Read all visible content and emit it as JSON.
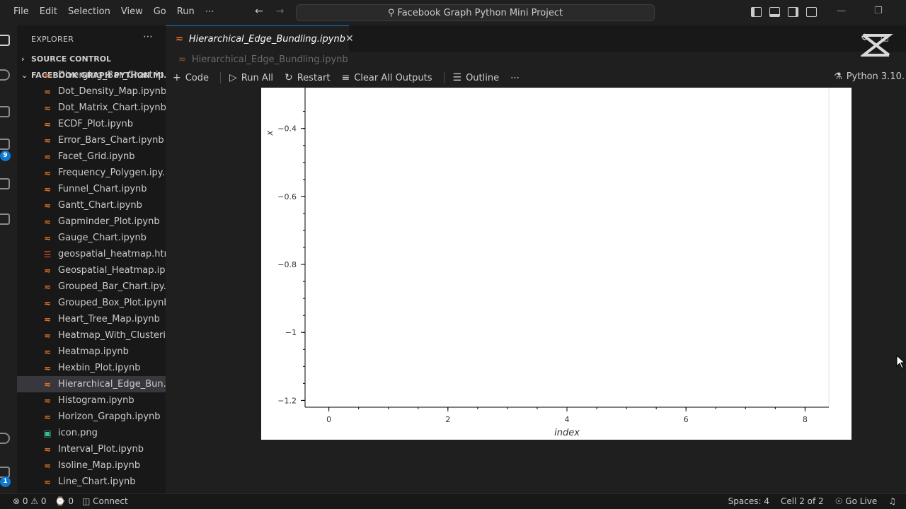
{
  "menu": [
    "File",
    "Edit",
    "Selection",
    "View",
    "Go",
    "Run",
    "⋯"
  ],
  "search": {
    "text": "Facebook Graph Python Mini Project"
  },
  "sidebar": {
    "header": "EXPLORER",
    "dots": "⋯",
    "source_control": "SOURCE CONTROL",
    "project": "FACEBOOK GRAPH PYTHON MI...",
    "files": [
      {
        "name": "Diverging_Bar_Chart.ip...",
        "type": "nb"
      },
      {
        "name": "Dot_Density_Map.ipynb",
        "type": "nb"
      },
      {
        "name": "Dot_Matrix_Chart.ipynb",
        "type": "nb"
      },
      {
        "name": "ECDF_Plot.ipynb",
        "type": "nb"
      },
      {
        "name": "Error_Bars_Chart.ipynb",
        "type": "nb"
      },
      {
        "name": "Facet_Grid.ipynb",
        "type": "nb"
      },
      {
        "name": "Frequency_Polygen.ipy...",
        "type": "nb"
      },
      {
        "name": "Funnel_Chart.ipynb",
        "type": "nb"
      },
      {
        "name": "Gantt_Chart.ipynb",
        "type": "nb"
      },
      {
        "name": "Gapminder_Plot.ipynb",
        "type": "nb"
      },
      {
        "name": "Gauge_Chart.ipynb",
        "type": "nb"
      },
      {
        "name": "geospatial_heatmap.html",
        "type": "html"
      },
      {
        "name": "Geospatial_Heatmap.ip...",
        "type": "nb"
      },
      {
        "name": "Grouped_Bar_Chart.ipy...",
        "type": "nb"
      },
      {
        "name": "Grouped_Box_Plot.ipynb",
        "type": "nb"
      },
      {
        "name": "Heart_Tree_Map.ipynb",
        "type": "nb"
      },
      {
        "name": "Heatmap_With_Clusteri...",
        "type": "nb"
      },
      {
        "name": "Heatmap.ipynb",
        "type": "nb"
      },
      {
        "name": "Hexbin_Plot.ipynb",
        "type": "nb"
      },
      {
        "name": "Hierarchical_Edge_Bun...",
        "type": "nb",
        "active": true
      },
      {
        "name": "Histogram.ipynb",
        "type": "nb"
      },
      {
        "name": "Horizon_Grapgh.ipynb",
        "type": "nb"
      },
      {
        "name": "icon.png",
        "type": "png"
      },
      {
        "name": "Interval_Plot.ipynb",
        "type": "nb"
      },
      {
        "name": "Isoline_Map.ipynb",
        "type": "nb"
      },
      {
        "name": "Line_Chart.ipynb",
        "type": "nb"
      }
    ]
  },
  "tab": {
    "title": "Hierarchical_Edge_Bundling.ipynb",
    "close": "✕"
  },
  "breadcrumb": "Hierarchical_Edge_Bundling.ipynb",
  "toolbar": {
    "code": "Code",
    "run_all": "Run All",
    "restart": "Restart",
    "clear": "Clear All Outputs",
    "outline": "Outline",
    "more": "⋯",
    "kernel": "Python 3.10."
  },
  "chart_data": {
    "type": "line",
    "xlabel": "index",
    "ylabel": "x",
    "x_ticks": [
      0,
      2,
      4,
      6,
      8
    ],
    "y_ticks": [
      -0.4,
      -0.6,
      -0.8,
      -1,
      -1.2
    ],
    "y_tick_labels": [
      "−0.4",
      "−0.6",
      "−0.8",
      "−1",
      "−1.2"
    ],
    "xlim": [
      -0.4,
      8.4
    ],
    "ylim": [
      -1.22,
      -0.28
    ],
    "series": []
  },
  "status": {
    "errors": "0",
    "warnings": "0",
    "ports": "0",
    "connect": "Connect",
    "spaces": "Spaces: 4",
    "cell": "Cell 2 of 2",
    "golive": "Go Live"
  },
  "activity_badges": [
    "9",
    "1"
  ]
}
